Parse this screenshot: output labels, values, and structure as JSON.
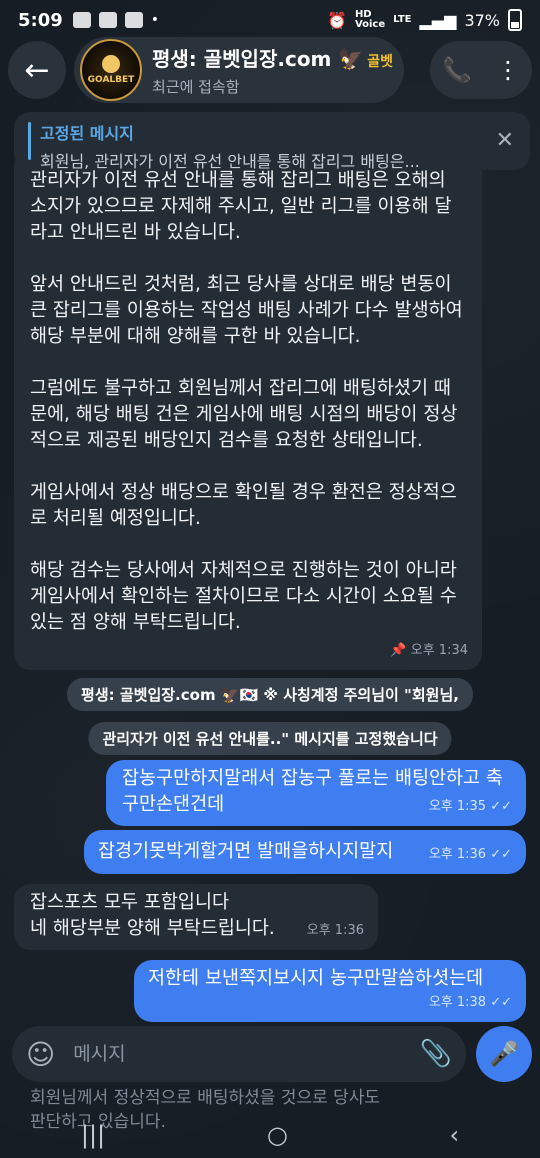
{
  "status_bar": {
    "time": "5:09",
    "hd_label": "HD",
    "voice_label": "Voice",
    "network": "LTE",
    "battery": "37%"
  },
  "header": {
    "back_icon": "arrow-left-icon",
    "avatar_text": "GOALBET",
    "chat_name": "평생: 골벳입장.com",
    "name_tag": "골벳",
    "last_seen": "최근에 접속함",
    "call_icon": "phone-icon",
    "menu_icon": "more-vertical-icon"
  },
  "pinned": {
    "title": "고정된 메시지",
    "preview": "회원님, 관리자가 이전 유선 안내를 통해 잡리그 배팅은..."
  },
  "messages": {
    "long": {
      "p1": "관리자가 이전 유선 안내를 통해 잡리그 배팅은 오해의 소지가 있으므로 자제해 주시고, 일반 리그를 이용해 달라고 안내드린 바 있습니다.",
      "p2": "앞서 안내드린 것처럼, 최근 당사를 상대로 배당 변동이 큰 잡리그를 이용하는 작업성 배팅 사례가 다수 발생하여 해당 부분에 대해 양해를 구한 바 있습니다.",
      "p3": "그럼에도 불구하고 회원님께서 잡리그에 배팅하셨기 때문에, 해당 배팅 건은 게임사에 배팅 시점의 배당이 정상적으로 제공된 배당인지 검수를 요청한 상태입니다.",
      "p4": "게임사에서 정상 배당으로 확인될 경우 환전은 정상적으로 처리될 예정입니다.",
      "p5": "해당 검수는 당사에서 자체적으로 진행하는 것이 아니라 게임사에서 확인하는 절차이므로 다소 시간이 소요될 수 있는 점 양해 부탁드립니다.",
      "time": "오후 1:34"
    },
    "service_line1": "평생: 골벳입장.com 🦅🇰🇷 ※ 사칭계정 주의님이 \"회원님,",
    "service_line2": "관리자가 이전 유선 안내를..\" 메시지를 고정했습니다",
    "out1": {
      "text": "잡농구만하지말래서 잡농구 풀로는 배팅안하고 축구만손댄건데",
      "time": "오후 1:35"
    },
    "out2": {
      "text": "잡경기못박게할거면 발매을하시지말지",
      "time": "오후 1:36"
    },
    "in2": {
      "line1": "잡스포츠 모두 포함입니다",
      "line2": "네 해당부분 양해 부탁드립니다.",
      "time": "오후 1:36"
    },
    "out3": {
      "text": "저한테 보낸쪽지보시지 농구만말씀하셧는데",
      "time": "오후 1:38"
    }
  },
  "composer": {
    "placeholder": "메시지",
    "emoji_icon": "smiley-icon",
    "attach_icon": "paperclip-icon",
    "mic_icon": "microphone-icon"
  },
  "underlay_text": {
    "line1": "회원님께서 정상적으로 배팅하셨을 것으로 당사도",
    "line2": "판단하고 있습니다."
  }
}
